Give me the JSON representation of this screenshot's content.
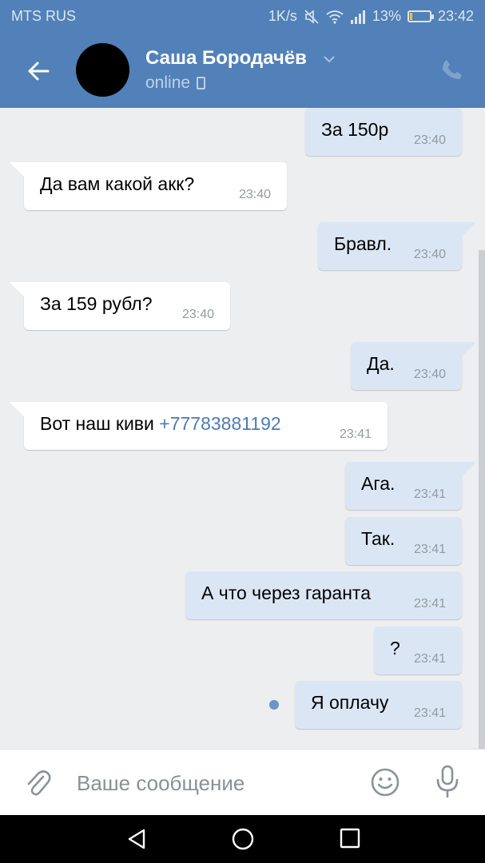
{
  "status_bar": {
    "carrier": "MTS RUS",
    "net_speed": "1K/s",
    "battery": "13%",
    "battery_level": 0.13,
    "time": "23:42"
  },
  "header": {
    "contact_name": "Саша Бородачёв",
    "contact_status": "online"
  },
  "messages": [
    {
      "dir": "out",
      "text": "За 150р",
      "time": "23:40"
    },
    {
      "dir": "in",
      "text": "Да вам какой акк?",
      "time": "23:40"
    },
    {
      "dir": "out",
      "text": "Бравл.",
      "time": "23:40"
    },
    {
      "dir": "in",
      "text": "За 159 рубл?",
      "time": "23:40"
    },
    {
      "dir": "out",
      "text": "Да.",
      "time": "23:40"
    },
    {
      "dir": "in",
      "text": "Вот наш киви",
      "link": "+77783881192",
      "time": "23:41"
    },
    {
      "dir": "out",
      "text": "Ага.",
      "time": "23:41"
    },
    {
      "dir": "out",
      "text": "Так.",
      "time": "23:41"
    },
    {
      "dir": "out",
      "text": "А что через гаранта",
      "time": "23:41"
    },
    {
      "dir": "out",
      "text": "?",
      "time": "23:41"
    },
    {
      "dir": "out",
      "text": "Я оплачу",
      "time": "23:41",
      "unread": true
    }
  ],
  "composer": {
    "placeholder": "Ваше сообщение"
  },
  "colors": {
    "header_bg": "#5181b8",
    "outgoing_bubble": "#dbe6f5",
    "incoming_bubble": "#ffffff",
    "chat_bg": "#edeef0",
    "link": "#4a7cb5"
  }
}
